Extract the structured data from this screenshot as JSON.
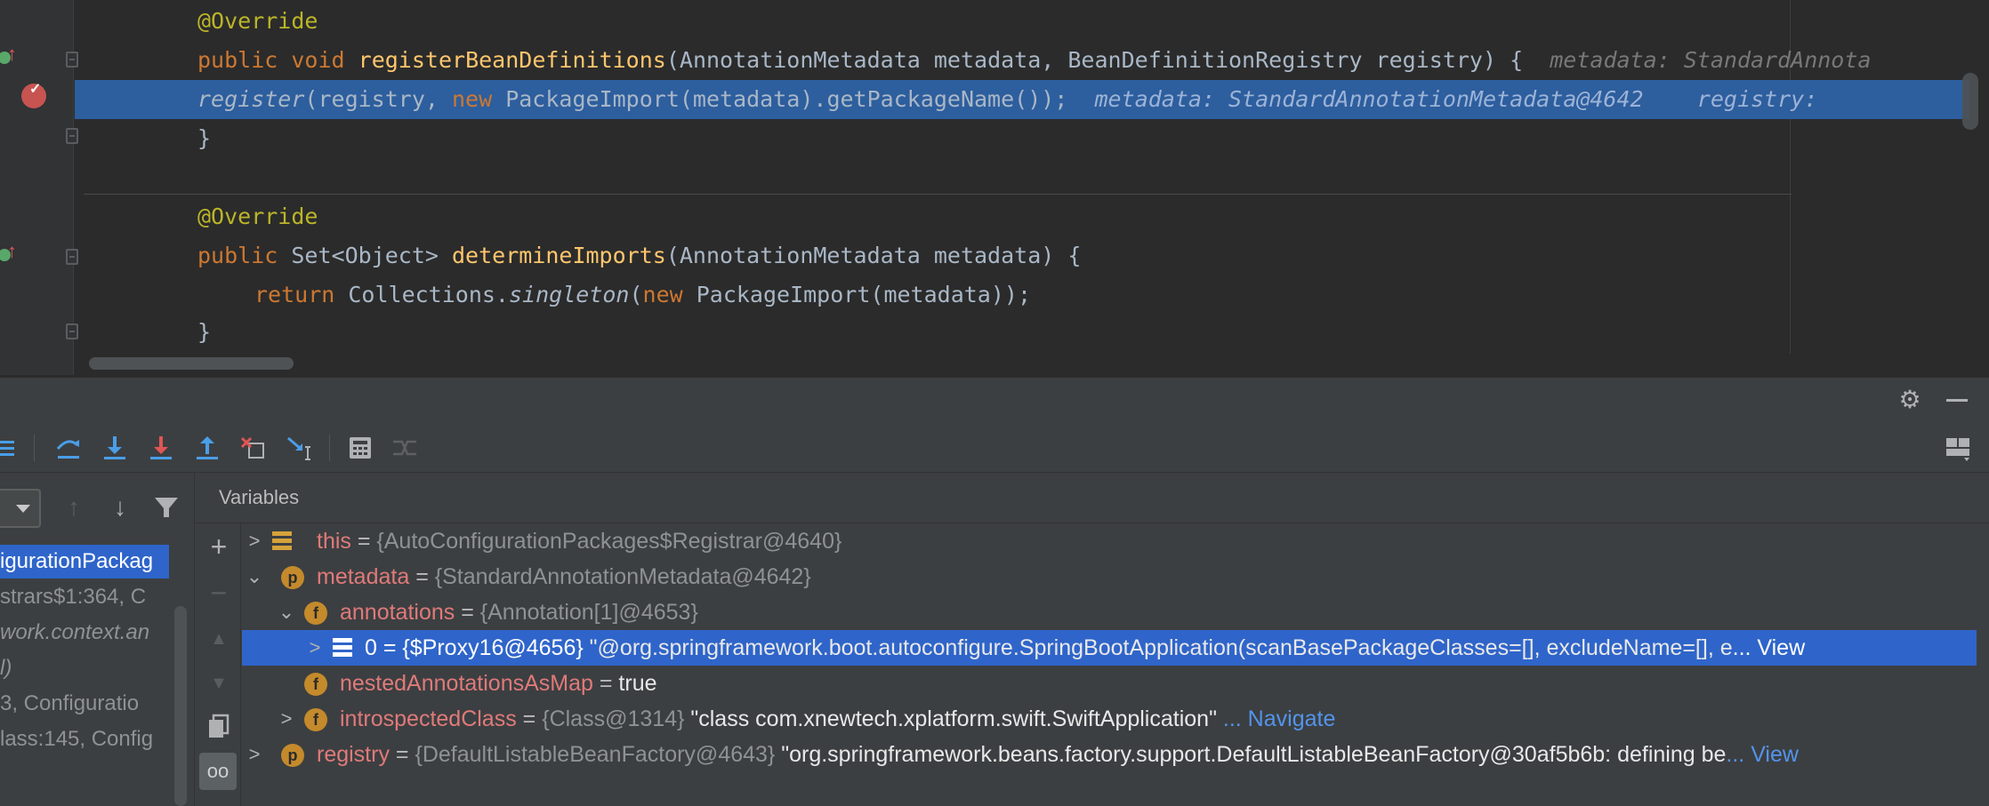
{
  "editor": {
    "lines": [
      {
        "annotation": "@Override"
      },
      {
        "kw1": "public",
        "kw2": "void",
        "method": "registerBeanDefinitions",
        "params": "(AnnotationMetadata metadata, BeanDefinitionRegistry registry) {",
        "hint": "metadata: StandardAnnota"
      },
      {
        "call": "register",
        "args1": "(registry, ",
        "kw_new": "new",
        "args2": " PackageImport(metadata).getPackageName());",
        "hint": "metadata: StandardAnnotationMetadata@4642    registry:"
      },
      {
        "brace": "}"
      },
      {
        "annotation": "@Override"
      },
      {
        "kw1": "public",
        "type": " Set<Object> ",
        "method": "determineImports",
        "params": "(AnnotationMetadata metadata) {"
      },
      {
        "kw_return": "return",
        "cls": " Collections.",
        "call": "singleton",
        "args1": "(",
        "kw_new": "new",
        "args2": " PackageImport(metadata));"
      },
      {
        "brace": "}"
      }
    ]
  },
  "debug": {
    "settings_icon": "gear-icon",
    "minimize_icon": "minimize-icon",
    "toolbar": [
      "threads-list-icon",
      "step-over-icon",
      "step-into-icon",
      "force-step-into-icon",
      "step-out-icon",
      "drop-frame-icon",
      "run-to-cursor-icon",
      "evaluate-expression-icon",
      "trace-stream-icon",
      "layout-icon"
    ],
    "frames": {
      "items": [
        {
          "label": "igurationPackag",
          "selected": true,
          "italic": false
        },
        {
          "label": "strars$1:364, C",
          "selected": false,
          "italic": false
        },
        {
          "label": "work.context.an",
          "selected": false,
          "italic": true
        },
        {
          "label": "l)",
          "selected": false,
          "italic": true
        },
        {
          "label": "3, Configuratio",
          "selected": false,
          "italic": false
        },
        {
          "label": "lass:145, Config",
          "selected": false,
          "italic": false
        }
      ]
    },
    "variables": {
      "tab_label": "Variables",
      "rows": [
        {
          "name": "this",
          "eq": " = ",
          "type": "{AutoConfigurationPackages$Registrar@4640}",
          "value": "",
          "link": ""
        },
        {
          "name": "metadata",
          "eq": " = ",
          "type": "{StandardAnnotationMetadata@4642}",
          "value": "",
          "link": ""
        },
        {
          "name": "annotations",
          "eq": " = ",
          "type": "{Annotation[1]@4653}",
          "value": "",
          "link": ""
        },
        {
          "name": "0",
          "eq": " = ",
          "type": "{$Proxy16@4656}",
          "value": " \"@org.springframework.boot.autoconfigure.SpringBootApplication(scanBasePackageClasses=[], excludeName=[], e",
          "link": "... View"
        },
        {
          "name": "nestedAnnotationsAsMap",
          "eq": " = ",
          "type": "",
          "value": "true",
          "link": ""
        },
        {
          "name": "introspectedClass",
          "eq": " = ",
          "type": "{Class@1314}",
          "value": " \"class com.xnewtech.xplatform.swift.SwiftApplication\"",
          "link": " ... Navigate"
        },
        {
          "name": "registry",
          "eq": " = ",
          "type": "{DefaultListableBeanFactory@4643}",
          "value": " \"org.springframework.beans.factory.support.DefaultListableBeanFactory@30af5b6b: defining be",
          "link": "... View"
        }
      ]
    }
  }
}
